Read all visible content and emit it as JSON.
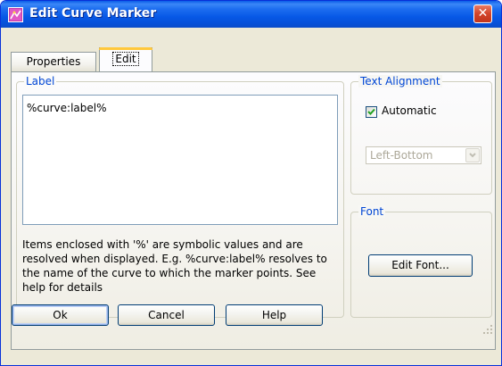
{
  "window": {
    "title": "Edit Curve Marker",
    "icon": "curve-marker-app-icon",
    "close_icon": "close-icon"
  },
  "tabs": [
    {
      "label": "Properties",
      "underline": "",
      "selected": false
    },
    {
      "label": "Edit",
      "selected": true
    }
  ],
  "label_group": {
    "title": "Label",
    "text_value": "%curve:label%",
    "hint": "Items enclosed with '%' are symbolic values and are resolved when displayed. E.g. %curve:label% resolves to the name of the curve to which the marker points. See help for details"
  },
  "text_alignment": {
    "title": "Text Alignment",
    "automatic_label": "Automatic",
    "automatic_checked": true,
    "position_value": "Left-Bottom"
  },
  "font_group": {
    "title": "Font",
    "edit_font_label": "Edit Font..."
  },
  "buttons": {
    "ok": "Ok",
    "cancel": "Cancel",
    "help": "Help"
  },
  "colors": {
    "titlebar": "#0a5ce8",
    "close_button": "#d2442a",
    "group_title": "#0046d5",
    "dialog_bg": "#ece9d8"
  }
}
